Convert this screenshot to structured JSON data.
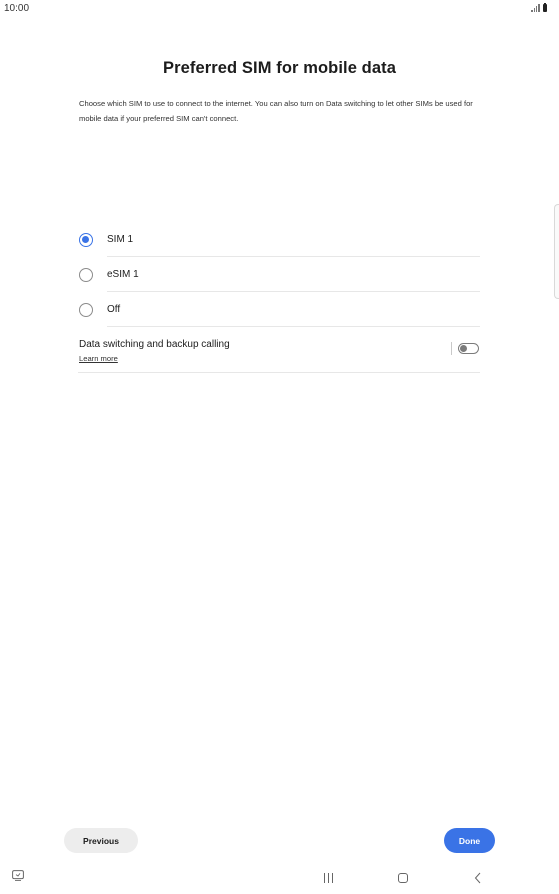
{
  "status_bar": {
    "time": "10:00",
    "icons": [
      "signal-icon",
      "battery-icon"
    ]
  },
  "page": {
    "title": "Preferred SIM for mobile data",
    "description": "Choose which SIM to use to connect to the internet. You can also turn on Data switching to let other SIMs be used for mobile data if your preferred SIM can't connect."
  },
  "options": [
    {
      "label": "SIM 1",
      "selected": true
    },
    {
      "label": "eSIM 1",
      "selected": false
    },
    {
      "label": "Off",
      "selected": false
    }
  ],
  "data_switching": {
    "title": "Data switching and backup calling",
    "link": "Learn more",
    "enabled": false
  },
  "buttons": {
    "previous": "Previous",
    "done": "Done"
  },
  "nav_bar": {
    "icons": [
      "screen-recorder-icon",
      "recents-icon",
      "home-icon",
      "back-icon"
    ]
  },
  "colors": {
    "accent": "#3a73e6",
    "secondary_button": "#ededed",
    "divider": "#e7e7e7"
  }
}
